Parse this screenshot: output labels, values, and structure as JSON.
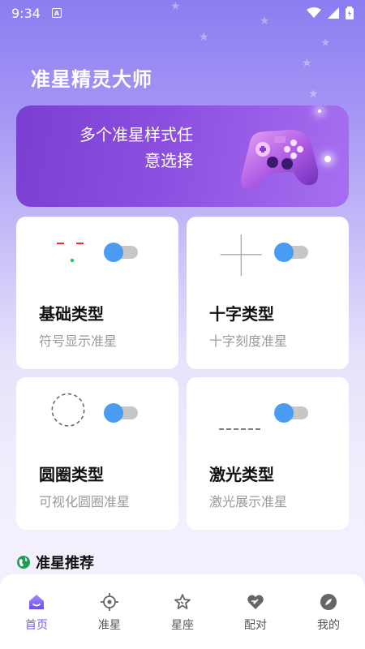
{
  "status": {
    "time": "9:34",
    "a_badge": "A"
  },
  "app_title": "准星精灵大师",
  "banner": {
    "line1": "多个准星样式任",
    "line2": "意选择"
  },
  "cards": [
    {
      "title": "基础类型",
      "subtitle": "符号显示准星",
      "icon": "dot-crosshair-icon",
      "enabled": true
    },
    {
      "title": "十字类型",
      "subtitle": "十字刻度准星",
      "icon": "cross-crosshair-icon",
      "enabled": true
    },
    {
      "title": "圆圈类型",
      "subtitle": "可视化圆圈准星",
      "icon": "circle-crosshair-icon",
      "enabled": true
    },
    {
      "title": "激光类型",
      "subtitle": "激光展示准星",
      "icon": "laser-crosshair-icon",
      "enabled": true
    }
  ],
  "section": {
    "title": "准星推荐"
  },
  "tabs": [
    {
      "label": "首页",
      "icon": "home-icon",
      "active": true
    },
    {
      "label": "准星",
      "icon": "crosshair-icon",
      "active": false
    },
    {
      "label": "星座",
      "icon": "constellation-icon",
      "active": false
    },
    {
      "label": "配对",
      "icon": "heart-icon",
      "active": false
    },
    {
      "label": "我的",
      "icon": "profile-icon",
      "active": false
    }
  ],
  "colors": {
    "accent": "#7a5af0",
    "toggle_on": "#4a9cf2"
  }
}
